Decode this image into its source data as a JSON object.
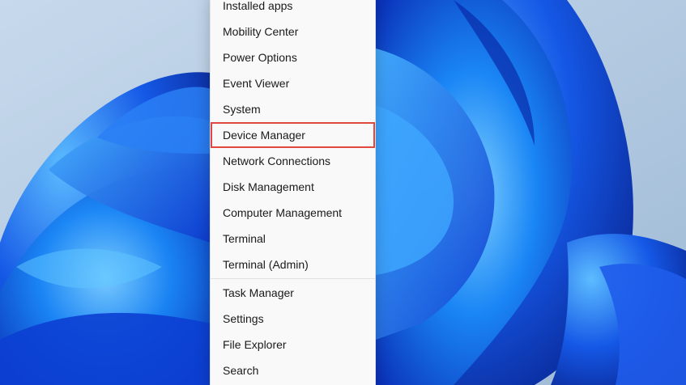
{
  "wallpaper": {
    "name": "Windows 11 bloom wallpaper",
    "background_color": "#b9cde2",
    "accent_colors": [
      "#0a2fb8",
      "#1a63f0",
      "#3aa5ff",
      "#7fd0ff"
    ]
  },
  "context_menu": {
    "highlight_color": "#e0473f",
    "highlighted_item": "Device Manager",
    "groups": [
      {
        "items": [
          {
            "label": "Installed apps"
          },
          {
            "label": "Mobility Center"
          },
          {
            "label": "Power Options"
          },
          {
            "label": "Event Viewer"
          },
          {
            "label": "System"
          },
          {
            "label": "Device Manager"
          },
          {
            "label": "Network Connections"
          },
          {
            "label": "Disk Management"
          },
          {
            "label": "Computer Management"
          },
          {
            "label": "Terminal"
          },
          {
            "label": "Terminal (Admin)"
          }
        ]
      },
      {
        "items": [
          {
            "label": "Task Manager"
          },
          {
            "label": "Settings"
          },
          {
            "label": "File Explorer"
          },
          {
            "label": "Search"
          }
        ]
      }
    ]
  }
}
